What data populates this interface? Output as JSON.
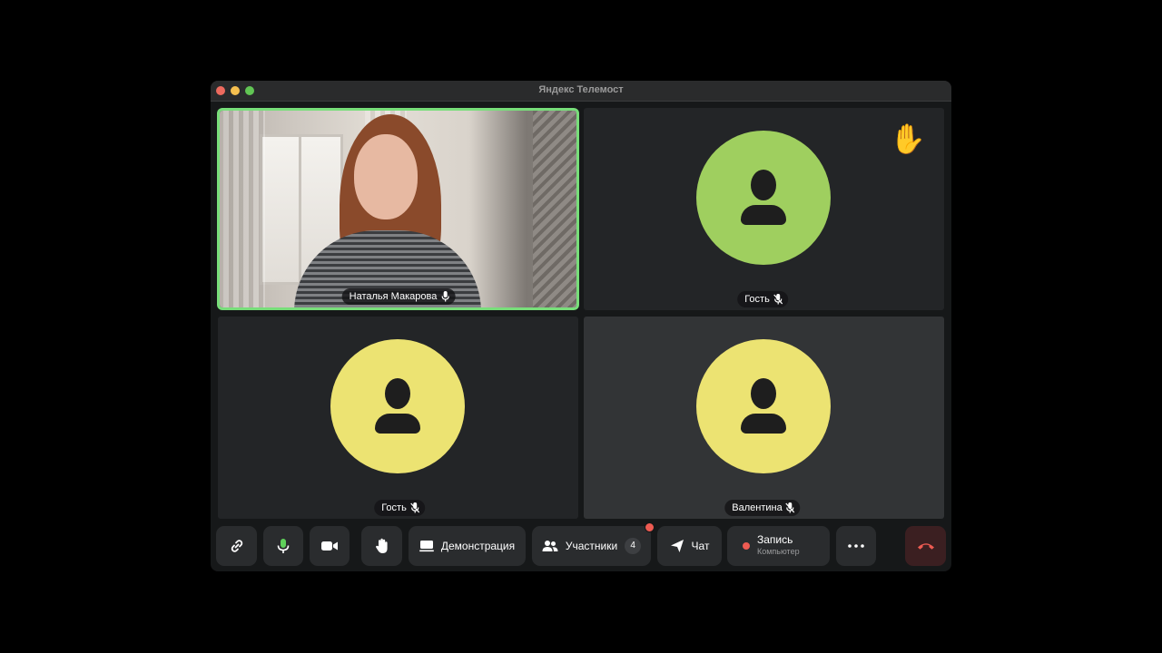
{
  "window": {
    "title": "Яндекс Телемост"
  },
  "participants": [
    {
      "name": "Наталья Макарова",
      "speaking": true,
      "muted": false,
      "video": true
    },
    {
      "name": "Гость",
      "muted": true,
      "avatar_color": "#9fcf5f",
      "hand_raised": true,
      "hand_icon": "raised-hand-emoji"
    },
    {
      "name": "Гость",
      "muted": true,
      "avatar_color": "#ece372"
    },
    {
      "name": "Валентина",
      "muted": true,
      "avatar_color": "#ece372"
    }
  ],
  "toolbar": {
    "screen_share_label": "Демонстрация",
    "participants_label": "Участники",
    "participants_count": "4",
    "chat_label": "Чат",
    "record_label": "Запись",
    "record_sub": "Компьютер"
  },
  "colors": {
    "speaking_border": "#78de7a",
    "mic_active": "#5fd05a",
    "notification": "#ee5b52",
    "hangup_icon": "#ee5b52"
  }
}
